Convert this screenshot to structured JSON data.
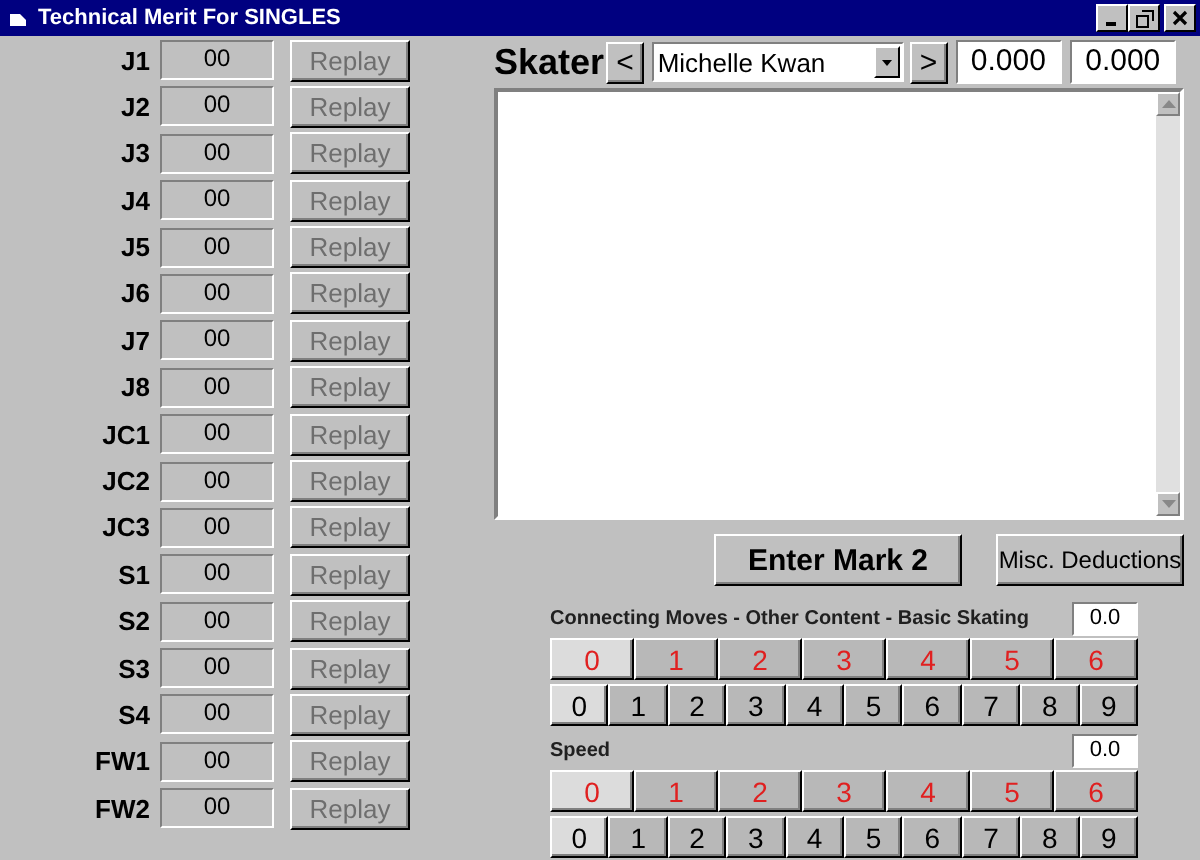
{
  "window": {
    "title": "Technical Merit For SINGLES"
  },
  "judge_groups": [
    {
      "judges": [
        {
          "label": "J1",
          "value": "00",
          "action": "Replay",
          "disabled": true
        },
        {
          "label": "J2",
          "value": "00",
          "action": "Replay",
          "disabled": true
        },
        {
          "label": "J3",
          "value": "00",
          "action": "Replay",
          "disabled": true
        },
        {
          "label": "J4",
          "value": "00",
          "action": "Replay",
          "disabled": true
        },
        {
          "label": "J5",
          "value": "00",
          "action": "Replay",
          "disabled": true
        },
        {
          "label": "J6",
          "value": "00",
          "action": "Replay",
          "disabled": true
        },
        {
          "label": "J7",
          "value": "00",
          "action": "Replay",
          "disabled": true
        },
        {
          "label": "J8",
          "value": "00",
          "action": "Replay",
          "disabled": true
        }
      ]
    },
    {
      "judges": [
        {
          "label": "JC1",
          "value": "00",
          "action": "Replay",
          "disabled": true
        },
        {
          "label": "JC2",
          "value": "00",
          "action": "Replay",
          "disabled": true
        },
        {
          "label": "JC3",
          "value": "00",
          "action": "Replay",
          "disabled": true
        }
      ]
    },
    {
      "judges": [
        {
          "label": "S1",
          "value": "00",
          "action": "Replay",
          "disabled": true
        },
        {
          "label": "S2",
          "value": "00",
          "action": "Replay",
          "disabled": true
        },
        {
          "label": "S3",
          "value": "00",
          "action": "Replay",
          "disabled": true
        },
        {
          "label": "S4",
          "value": "00",
          "action": "Replay",
          "disabled": true
        }
      ]
    },
    {
      "judges": [
        {
          "label": "FW1",
          "value": "00",
          "action": "Replay",
          "disabled": true
        },
        {
          "label": "FW2",
          "value": "00",
          "action": "Replay",
          "disabled": true
        }
      ]
    }
  ],
  "skater": {
    "label": "Skater",
    "prev": "<",
    "name": "Michelle Kwan",
    "next": ">",
    "score_1": "0.000",
    "score_2": "0.000"
  },
  "actions": [
    "Enter Mark 2",
    "Misc. Deductions"
  ],
  "marks": [
    {
      "title": "Connecting Moves  -  Other Content  -  Basic Skating",
      "value": "0.0",
      "whole": [
        {
          "label": "0",
          "selected": true
        },
        {
          "label": "1",
          "selected": false
        },
        {
          "label": "2",
          "selected": false
        },
        {
          "label": "3",
          "selected": false
        },
        {
          "label": "4",
          "selected": false
        },
        {
          "label": "5",
          "selected": false
        },
        {
          "label": "6",
          "selected": false
        }
      ],
      "tenths": [
        {
          "label": "0",
          "selected": true
        },
        {
          "label": "1",
          "selected": false
        },
        {
          "label": "2",
          "selected": false
        },
        {
          "label": "3",
          "selected": false
        },
        {
          "label": "4",
          "selected": false
        },
        {
          "label": "5",
          "selected": false
        },
        {
          "label": "6",
          "selected": false
        },
        {
          "label": "7",
          "selected": false
        },
        {
          "label": "8",
          "selected": false
        },
        {
          "label": "9",
          "selected": false
        }
      ]
    },
    {
      "title": "Speed",
      "value": "0.0",
      "whole": [
        {
          "label": "0",
          "selected": true
        },
        {
          "label": "1",
          "selected": false
        },
        {
          "label": "2",
          "selected": false
        },
        {
          "label": "3",
          "selected": false
        },
        {
          "label": "4",
          "selected": false
        },
        {
          "label": "5",
          "selected": false
        },
        {
          "label": "6",
          "selected": false
        }
      ],
      "tenths": [
        {
          "label": "0",
          "selected": true
        },
        {
          "label": "1",
          "selected": false
        },
        {
          "label": "2",
          "selected": false
        },
        {
          "label": "3",
          "selected": false
        },
        {
          "label": "4",
          "selected": false
        },
        {
          "label": "5",
          "selected": false
        },
        {
          "label": "6",
          "selected": false
        },
        {
          "label": "7",
          "selected": false
        },
        {
          "label": "8",
          "selected": false
        },
        {
          "label": "9",
          "selected": false
        }
      ]
    }
  ]
}
